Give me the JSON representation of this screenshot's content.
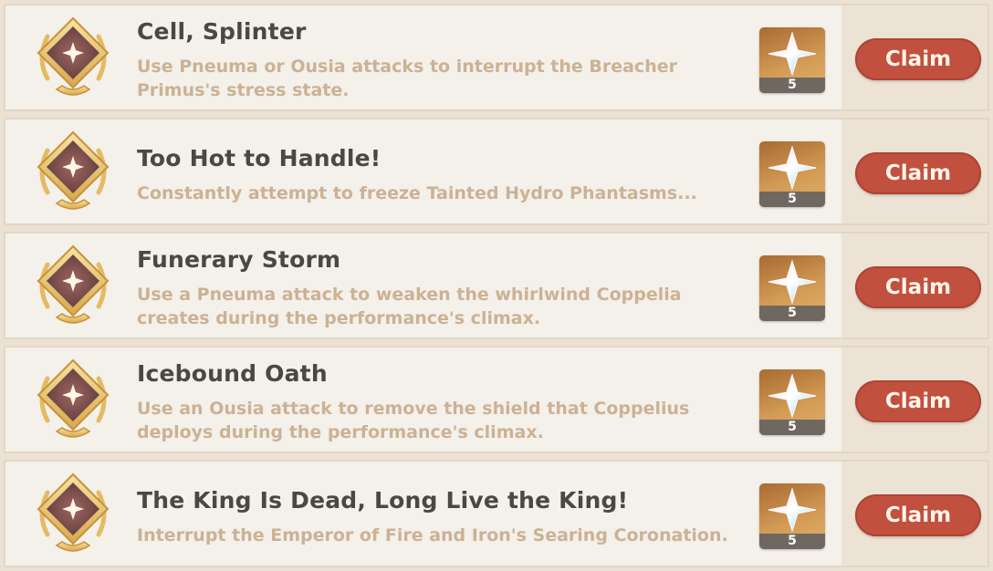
{
  "colors": {
    "title": "#4a4744",
    "description": "#cbb294",
    "claim_button": "#c1503f",
    "row_background": "#f4f0ea"
  },
  "achievements": [
    {
      "icon": "achievement-medal-icon",
      "title": "Cell, Splinter",
      "description": "Use Pneuma or Ousia attacks to interrupt the Breacher Primus's stress state.",
      "reward_icon": "primogem-icon",
      "reward_count": "5",
      "claim_label": "Claim"
    },
    {
      "icon": "achievement-medal-icon",
      "title": "Too Hot to Handle!",
      "description": "Constantly attempt to freeze Tainted Hydro Phantasms...",
      "reward_icon": "primogem-icon",
      "reward_count": "5",
      "claim_label": "Claim"
    },
    {
      "icon": "achievement-medal-icon",
      "title": "Funerary Storm",
      "description": "Use a Pneuma attack to weaken the whirlwind Coppelia creates during the performance's climax.",
      "reward_icon": "primogem-icon",
      "reward_count": "5",
      "claim_label": "Claim"
    },
    {
      "icon": "achievement-medal-icon",
      "title": "Icebound Oath",
      "description": "Use an Ousia attack to remove the shield that Coppelius deploys during the performance's climax.",
      "reward_icon": "primogem-icon",
      "reward_count": "5",
      "claim_label": "Claim"
    },
    {
      "icon": "achievement-medal-icon",
      "title": "The King Is Dead, Long Live the King!",
      "description": "Interrupt the Emperor of Fire and Iron's Searing Coronation.",
      "reward_icon": "primogem-icon",
      "reward_count": "5",
      "claim_label": "Claim"
    }
  ]
}
